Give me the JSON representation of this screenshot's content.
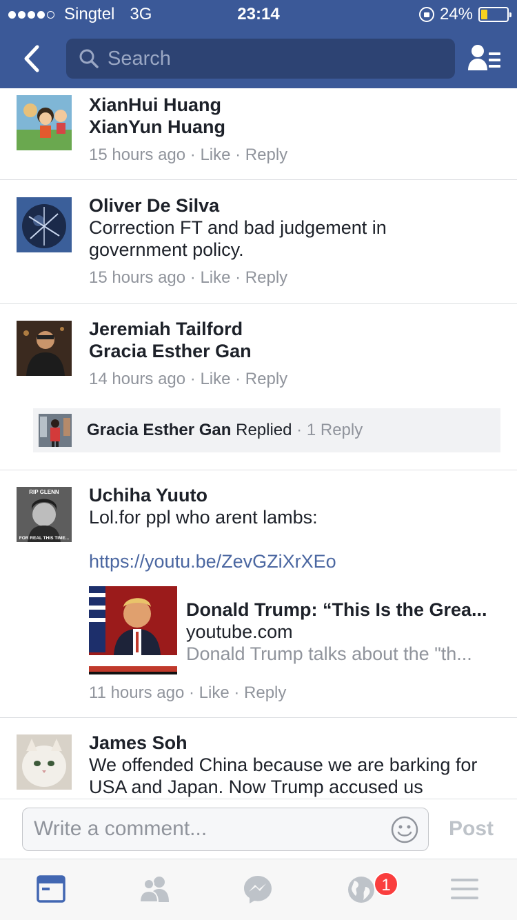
{
  "status_bar": {
    "carrier": "Singtel",
    "network": "3G",
    "time": "23:14",
    "battery": "24%",
    "battery_level": 0.24
  },
  "nav": {
    "search_placeholder": "Search"
  },
  "comments": [
    {
      "names": [
        "XianHui Huang",
        "XianYun Huang"
      ],
      "time": "15 hours ago",
      "like": "Like",
      "reply": "Reply"
    },
    {
      "name": "Oliver De Silva",
      "text": "Correction FT and bad judgement  in government policy.",
      "time": "15 hours ago",
      "like": "Like",
      "reply": "Reply"
    },
    {
      "names": [
        "Jeremiah Tailford",
        "Gracia Esther Gan"
      ],
      "time": "14 hours ago",
      "like": "Like",
      "reply": "Reply",
      "replied": {
        "name": "Gracia Esther Gan",
        "verb": "Replied",
        "count": "1 Reply"
      }
    },
    {
      "name": "Uchiha Yuuto",
      "avatar_text_top": "RIP GLENN",
      "avatar_text_bottom": "FOR REAL THIS TIME...",
      "text": "Lol.for ppl who arent lambs:",
      "link": "https://youtu.be/ZevGZiXrXEo",
      "preview": {
        "title": "Donald Trump: “This Is the Grea...",
        "site": "youtube.com",
        "description": "Donald Trump talks about the \"th..."
      },
      "time": "11 hours ago",
      "like": "Like",
      "reply": "Reply"
    },
    {
      "name": "James Soh",
      "text": "We offended China because we are barking for USA and Japan.  Now Trump accused us"
    }
  ],
  "composer": {
    "placeholder": "Write a comment...",
    "post_label": "Post"
  },
  "tabbar": {
    "notifications_badge": "1"
  },
  "colors": {
    "brand": "#3b5998",
    "link": "#4b67a1",
    "badge": "#fa3e3e"
  }
}
